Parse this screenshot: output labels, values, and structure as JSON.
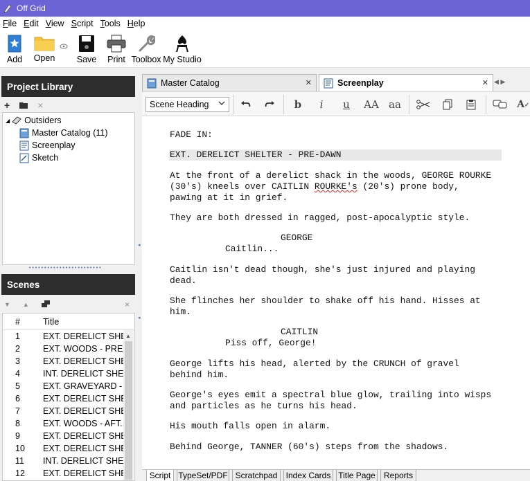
{
  "window": {
    "title": "Off Grid"
  },
  "menu": [
    "File",
    "Edit",
    "View",
    "Script",
    "Tools",
    "Help"
  ],
  "toolbar": {
    "add": "Add",
    "open": "Open",
    "save": "Save",
    "print": "Print",
    "toolbox": "Toolbox",
    "my_studio": "My Studio"
  },
  "project_library": {
    "title": "Project Library",
    "root": "Outsiders",
    "items": [
      "Master Catalog (11)",
      "Screenplay",
      "Sketch"
    ]
  },
  "scenes": {
    "title": "Scenes",
    "col_num": "#",
    "col_title": "Title",
    "rows": [
      {
        "num": "1",
        "title": "EXT. DERELICT SHE..."
      },
      {
        "num": "2",
        "title": "EXT. WOODS - PRE..."
      },
      {
        "num": "3",
        "title": "EXT. DERELICT SHE..."
      },
      {
        "num": "4",
        "title": "INT. DERELICT SHE..."
      },
      {
        "num": "5",
        "title": "EXT. GRAVEYARD - ..."
      },
      {
        "num": "6",
        "title": "EXT. DERELICT SHE..."
      },
      {
        "num": "7",
        "title": "EXT. DERELICT SHE..."
      },
      {
        "num": "8",
        "title": "EXT. WOODS - AFT..."
      },
      {
        "num": "9",
        "title": "EXT. DERELICT SHE..."
      },
      {
        "num": "10",
        "title": "EXT. DERELICT SHE..."
      },
      {
        "num": "11",
        "title": "INT. DERELICT SHE..."
      },
      {
        "num": "12",
        "title": "EXT. DERELICT SHE..."
      }
    ]
  },
  "tabs": {
    "master_catalog": "Master Catalog",
    "screenplay": "Screenplay"
  },
  "editor_toolbar": {
    "element": "Scene Heading",
    "bold": "b",
    "italic": "i",
    "underline": "u",
    "upper": "AA",
    "lower": "aa"
  },
  "script": {
    "fade_in": "FADE IN:",
    "heading": "EXT. DERELICT SHELTER - PRE-DAWN",
    "a1_l1": "At the front of a derelict shack in the woods, GEORGE ROURKE",
    "a1_l2a": "(30's) kneels over CAITLIN ",
    "a1_l2b": "ROURKE's",
    "a1_l2c": " (20's) prone body,",
    "a1_l3": "pawing at it in grief.",
    "a2": "They are both dressed in ragged, post-apocalyptic style.",
    "c1": "GEORGE",
    "d1": "Caitlin...",
    "a3_l1": "Caitlin isn't dead though, she's just injured and playing",
    "a3_l2": "dead.",
    "a4_l1": "She flinches her shoulder to shake off his hand. Hisses at",
    "a4_l2": "him.",
    "c2": "CAITLIN",
    "d2": "Piss off, George!",
    "a5_l1": "George lifts his head, alerted by the CRUNCH of gravel",
    "a5_l2": "behind him.",
    "a6_l1": "George's eyes emit a spectral blue glow, trailing into wisps",
    "a6_l2": "and particles as he turns his head.",
    "a7": "His mouth falls open in alarm.",
    "a8": "Behind George, TANNER (60's) steps from the shadows."
  },
  "bottom_tabs": [
    "Script",
    "TypeSet/PDF",
    "Scratchpad",
    "Index Cards",
    "Title Page",
    "Reports"
  ]
}
